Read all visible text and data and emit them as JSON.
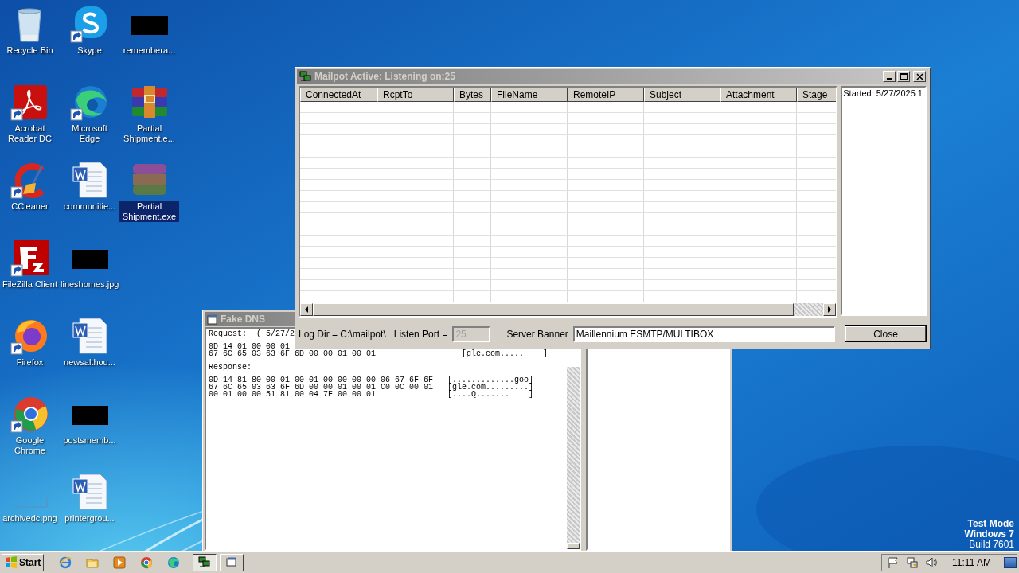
{
  "desktop": {
    "icons": [
      {
        "label": "Recycle Bin",
        "kind": "recycle",
        "shortcut": false,
        "selected": false
      },
      {
        "label": "Acrobat Reader DC",
        "kind": "acrobat",
        "shortcut": true,
        "selected": false
      },
      {
        "label": "CCleaner",
        "kind": "ccleaner",
        "shortcut": true,
        "selected": false
      },
      {
        "label": "FileZilla Client",
        "kind": "filezilla",
        "shortcut": true,
        "selected": false
      },
      {
        "label": "Firefox",
        "kind": "firefox",
        "shortcut": true,
        "selected": false
      },
      {
        "label": "Google Chrome",
        "kind": "chrome",
        "shortcut": true,
        "selected": false
      },
      {
        "label": "archivedc.png",
        "kind": "blank",
        "shortcut": false,
        "selected": false
      },
      {
        "label": "Skype",
        "kind": "skype",
        "shortcut": true,
        "selected": false
      },
      {
        "label": "Microsoft Edge",
        "kind": "edge",
        "shortcut": true,
        "selected": false
      },
      {
        "label": "communitie...",
        "kind": "word",
        "shortcut": false,
        "selected": false
      },
      {
        "label": "lineshomes.jpg",
        "kind": "dark",
        "shortcut": false,
        "selected": false
      },
      {
        "label": "newsalthou...",
        "kind": "word",
        "shortcut": false,
        "selected": false
      },
      {
        "label": "postsmemb...",
        "kind": "dark",
        "shortcut": false,
        "selected": false
      },
      {
        "label": "printergrou...",
        "kind": "word",
        "shortcut": false,
        "selected": false
      },
      {
        "label": "remembera...",
        "kind": "dark",
        "shortcut": false,
        "selected": false
      },
      {
        "label": "Partial Shipment.e...",
        "kind": "archive",
        "shortcut": false,
        "selected": false
      },
      {
        "label": "Partial Shipment.exe",
        "kind": "faded",
        "shortcut": false,
        "selected": true
      }
    ],
    "os_notice": [
      "Test Mode",
      "Windows 7",
      "Build 7601"
    ]
  },
  "fake_dns": {
    "title": "Fake DNS",
    "sections": [
      {
        "heading": "Request:  ( 5/27/2",
        "lines": [
          "0D 14 01 00 00 01",
          "67 6C 65 03 63 6F 6D 00 00 01 00 01                  [gle.com.....    ]"
        ]
      },
      {
        "heading": "Response:",
        "lines": [
          "0D 14 81 80 00 01 00 01 00 00 00 00 06 67 6F 6F   [.............goo]",
          "67 6C 65 03 63 6F 6D 00 00 01 00 01 C0 0C 00 01   [gle.com.........]",
          "00 01 00 00 51 81 00 04 7F 00 00 01               [....Q.......    ]"
        ]
      }
    ]
  },
  "mailpot": {
    "title": "Mailpot Active: Listening on:25",
    "columns": [
      "ConnectedAt",
      "RcptTo",
      "Bytes",
      "FileName",
      "RemoteIP",
      "Subject",
      "Attachment",
      "Stage"
    ],
    "log_lines": [
      "Started: 5/27/2025 1"
    ],
    "log_dir": "Log Dir = C:\\mailpot\\",
    "listen_port": {
      "label": "Listen Port =",
      "value": "25",
      "disabled": true
    },
    "server_banner": {
      "label": "Server Banner",
      "value": "Maillennium ESMTP/MULTIBOX"
    },
    "close_button": "Close"
  },
  "taskbar": {
    "start": "Start",
    "quick_launch": [
      {
        "kind": "ie"
      },
      {
        "kind": "folder"
      },
      {
        "kind": "media"
      },
      {
        "kind": "chrome"
      },
      {
        "kind": "edge"
      }
    ],
    "tasks": [
      {
        "kind": "mailpot",
        "selected": true
      },
      {
        "kind": "window",
        "selected": false
      }
    ],
    "tray": [
      {
        "kind": "flag"
      },
      {
        "kind": "network"
      },
      {
        "kind": "speaker"
      }
    ],
    "clock": "11:11 AM"
  }
}
